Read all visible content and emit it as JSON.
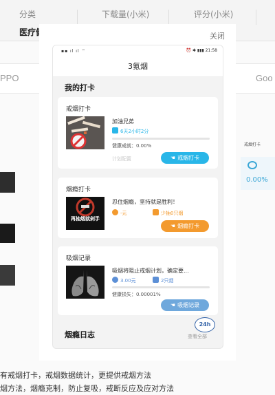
{
  "background": {
    "tabs": [
      {
        "label": "分类"
      },
      {
        "label": "下载量(小米)"
      },
      {
        "label": "评分(小米)"
      }
    ],
    "active_sub": "医疗健康",
    "row2_left": "PPO",
    "row2_right": "Goo",
    "right_card_label": "戒烟打卡",
    "right_card_value": "0.00%",
    "caption_line1": "有戒烟打卡，戒烟数据统计，更提供戒烟方法",
    "caption_line2": "烟方法，烟瘾克制，防止复吸，戒断反应及应对方法"
  },
  "modal": {
    "close_label": "关闭"
  },
  "phone": {
    "status_left": "▪▪ ıl ıl ⌔",
    "status_right": "⏰ ✱ ▮▮▮ 21:58",
    "app_title": "3氪烟",
    "my_checkin_title": "我的打卡",
    "cards": [
      {
        "title": "戒烟打卡",
        "name": "加油兄弟",
        "meta": [
          {
            "text": "6天2小时2分",
            "color": "#29b6e8"
          }
        ],
        "progress": 0.0,
        "stat": "健康成就：0.00%",
        "hint": "计划配置",
        "button_label": "戒烟打卡",
        "button_color": "#29b6e8"
      },
      {
        "title": "烟瘾打卡",
        "name": "忍住烟瘾，坚持就是胜利！",
        "meta": [
          {
            "text": "-元",
            "color": "#f39a2e"
          },
          {
            "text": "少抽0只烟",
            "color": "#f39a2e"
          }
        ],
        "image_text": "再抽烟就剁手",
        "button_label": "烟瘾打卡",
        "button_color": "#f39a2e"
      },
      {
        "title": "吸烟记录",
        "name": "吸烟将阻止戒烟计划，确定要...",
        "meta": [
          {
            "text": "3.00元",
            "color": "#5c8fd6"
          },
          {
            "text": "2只烟",
            "color": "#5c8fd6"
          }
        ],
        "progress": 0.0,
        "stat": "健康损失：0.00001%",
        "button_label": "吸烟记录",
        "button_color": "#6fa8dc"
      }
    ],
    "diary_title": "烟瘾日志",
    "badge_text": "24h",
    "more_label": "查看全部"
  }
}
